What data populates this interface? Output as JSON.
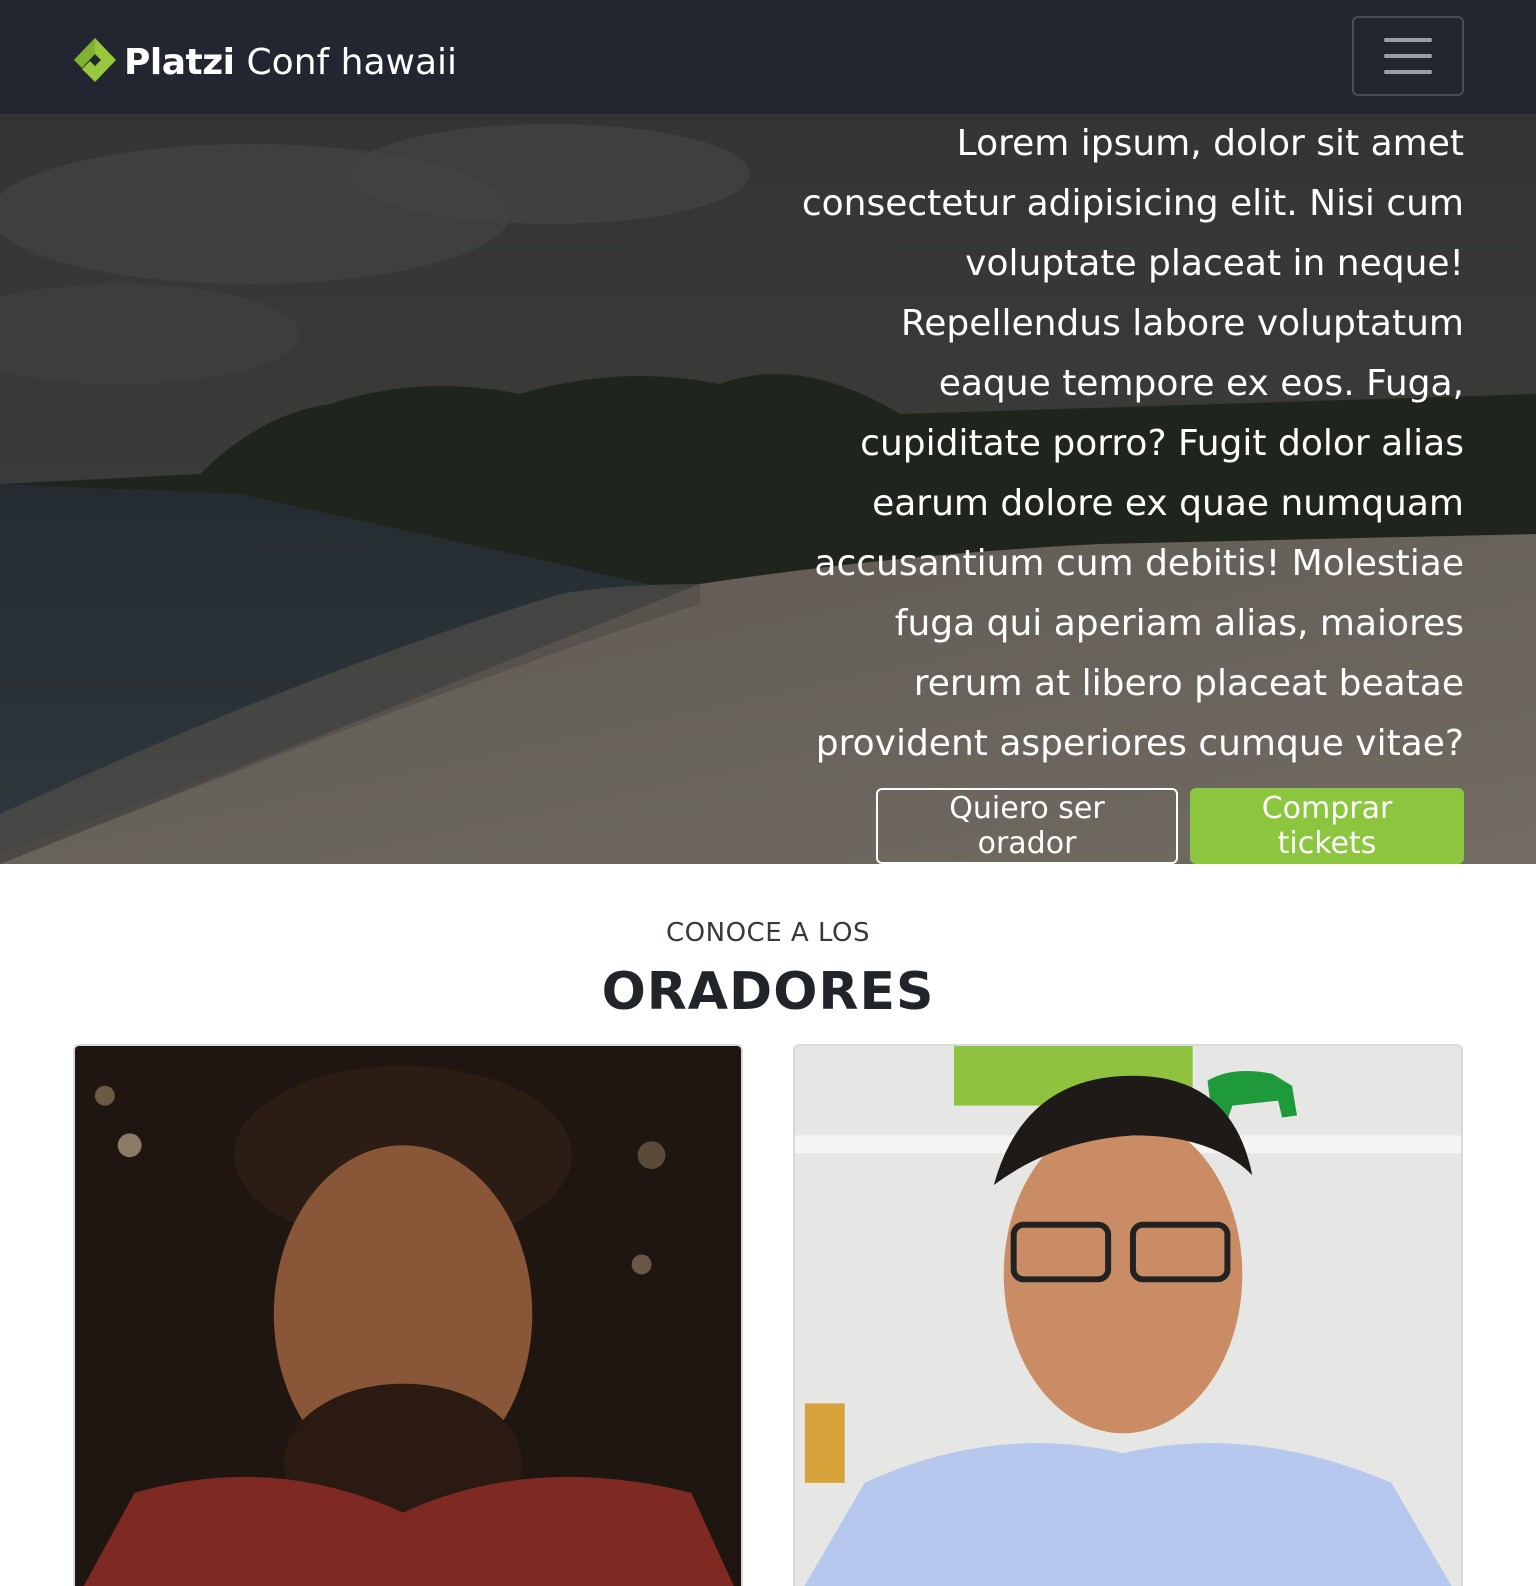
{
  "navbar": {
    "brand_platzi": "Platzi",
    "brand_conf": "Conf hawaii",
    "menu_icon": "hamburger-icon",
    "logo_icon": "platzi-logo-icon"
  },
  "hero": {
    "text": "Lorem ipsum, dolor sit amet consectetur adipisicing elit. Nisi cum voluptate placeat in neque! Repellendus labore voluptatum eaque tempore ex eos. Fuga, cupiditate porro? Fugit dolor alias earum dolore ex quae numquam accusantium cum debitis! Molestiae fuga qui aperiam alias, maiores rerum at libero placeat beatae provident asperiores cumque vitae?",
    "buttons": {
      "speaker": "Quiero ser orador",
      "tickets": "Comprar tickets"
    }
  },
  "speakers": {
    "kicker": "CONOCE A LOS",
    "title": "ORADORES"
  },
  "colors": {
    "navbar_bg": "#212631",
    "accent_green": "#8cc63f"
  }
}
